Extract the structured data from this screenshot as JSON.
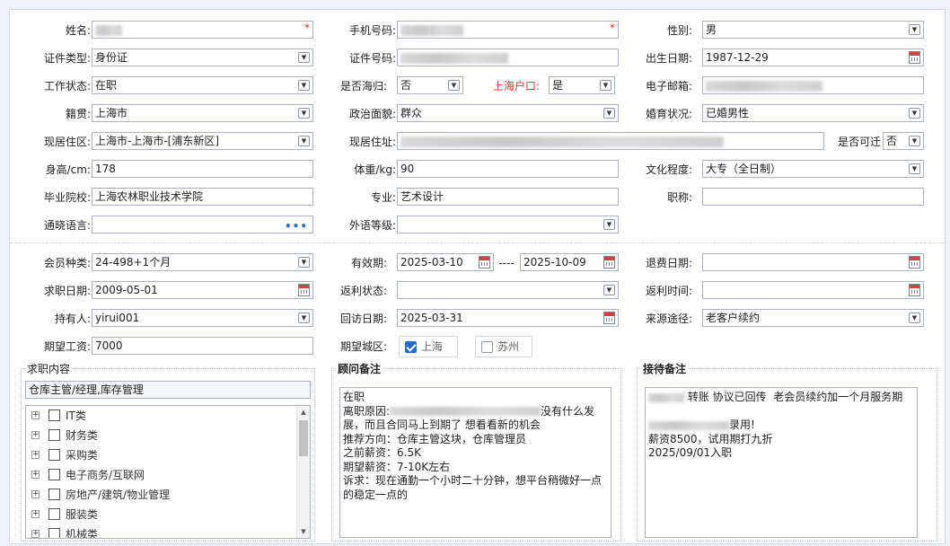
{
  "row1": {
    "name_label": "姓名:",
    "phone_label": "手机号码:",
    "gender_label": "性别:",
    "gender_value": "男"
  },
  "row2": {
    "id_type_label": "证件类型:",
    "id_type_value": "身份证",
    "id_no_label": "证件号码:",
    "birth_label": "出生日期:",
    "birth_value": "1987-12-29"
  },
  "row3": {
    "work_label": "工作状态:",
    "work_value": "在职",
    "overseas_label": "是否海归:",
    "overseas_value": "否",
    "hukou_label": "上海户口:",
    "hukou_value": "是",
    "email_label": "电子邮箱:"
  },
  "row4": {
    "origin_label": "籍贯:",
    "origin_value": "上海市",
    "political_label": "政治面貌:",
    "political_value": "群众",
    "marital_label": "婚育状况:",
    "marital_value": "已婚男性"
  },
  "row5": {
    "residence_label": "现居住区:",
    "residence_value": "上海市-上海市-[浦东新区]",
    "address_label": "现居住址:",
    "relocate_label": "是否可迁",
    "relocate_value": "否"
  },
  "row6": {
    "height_label": "身高/cm:",
    "height_value": "178",
    "weight_label": "体重/kg:",
    "weight_value": "90",
    "edu_label": "文化程度:",
    "edu_value": "大专（全日制）"
  },
  "row7": {
    "school_label": "毕业院校:",
    "school_value": "上海农林职业技术学院",
    "major_label": "专业:",
    "major_value": "艺术设计",
    "title_label": "职称:"
  },
  "row8": {
    "lang_label": "通晓语言:",
    "lang_more": "•••",
    "foreign_label": "外语等级:"
  },
  "row9": {
    "member_label": "会员种类:",
    "member_value": "24-498+1个月",
    "valid_label": "有效期:",
    "valid_from": "2025-03-10",
    "valid_sep": "----",
    "valid_to": "2025-10-09",
    "refund_label": "退费日期:"
  },
  "row10": {
    "seek_label": "求职日期:",
    "seek_value": "2009-05-01",
    "rebate_status_label": "返利状态:",
    "rebate_time_label": "返利时间:"
  },
  "row11": {
    "holder_label": "持有人:",
    "holder_value": "yirui001",
    "visit_label": "回访日期:",
    "visit_value": "2025-03-31",
    "source_label": "来源途径:",
    "source_value": "老客户续约"
  },
  "row12": {
    "salary_label": "期望工资:",
    "salary_value": "7000",
    "city_label": "期望城区:",
    "city_shanghai": "上海",
    "city_suzhou": "苏州"
  },
  "job_content": {
    "title": "求职内容",
    "selected": "仓库主管/经理,库存管理",
    "items": [
      "IT类",
      "财务类",
      "采购类",
      "电子商务/互联网",
      "房地产/建筑/物业管理",
      "服装类",
      "机械类"
    ]
  },
  "advisor_note": {
    "title": "顾问备注",
    "text_l1": "在职",
    "text_l2a": "离职原因:",
    "text_l2b": "没有什么发",
    "text_l3": "展，而且合同马上到期了 想看看新的机会",
    "text_l4": "推荐方向：仓库主管这块，仓库管理员",
    "text_l5": "之前薪资：6.5K",
    "text_l6": "期望薪资：7-10K左右",
    "text_l7": "诉求：现在通勤一个小时二十分钟，想平台稍微好一点",
    "text_l8": "的稳定一点的"
  },
  "reception_note": {
    "title": "接待备注",
    "text_l1": "转账 协议已回传  老会员续约加一个月服务期",
    "text_l2": "录用!",
    "text_l3": "薪资8500，试用期打九折",
    "text_l4": "2025/09/01入职"
  },
  "icons": {
    "dropdown": "dropdown-arrow-icon",
    "calendar": "calendar-icon"
  },
  "colors": {
    "required": "#e03030",
    "checkbox_on": "#1f6fd1"
  }
}
